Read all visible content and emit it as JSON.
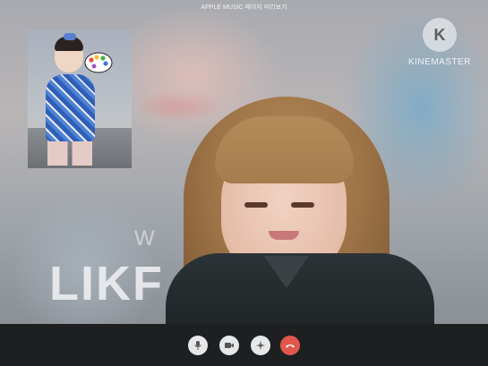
{
  "window": {
    "header_text": "APPLE MUSIC 페이지 미리보기"
  },
  "background": {
    "text_large": "LIKF",
    "text_small": "W"
  },
  "watermark": {
    "logo_glyph": "K",
    "brand": "KINEMASTER"
  },
  "controls": {
    "mic": "microphone-icon",
    "camera": "video-camera-icon",
    "effects": "sparkle-effects-icon",
    "end_call": "phone-hangup-icon",
    "end_color": "#e2574c"
  }
}
